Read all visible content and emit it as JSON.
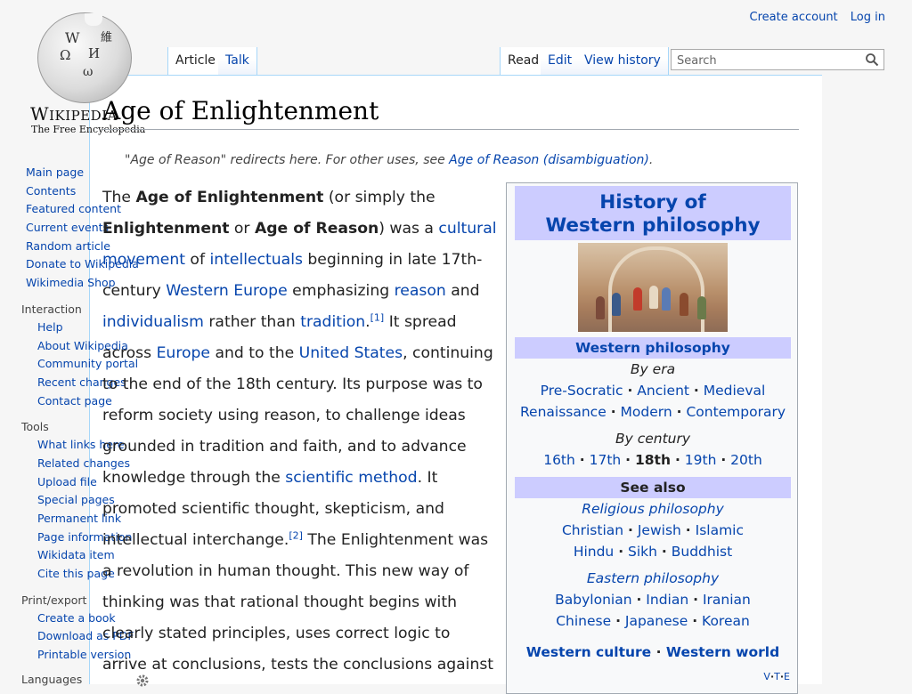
{
  "logo": {
    "wordmark_big": "W",
    "wordmark_rest": "IKIPEDIA",
    "tagline": "The Free Encyclopedia",
    "globe_glyphs": [
      "W",
      "Ω",
      "И",
      "ω",
      "維"
    ]
  },
  "personal": {
    "create_account": "Create account",
    "log_in": "Log in"
  },
  "tabs": {
    "article": "Article",
    "talk": "Talk",
    "read": "Read",
    "edit": "Edit",
    "view_history": "View history"
  },
  "search": {
    "placeholder": "Search",
    "icon": "search-icon"
  },
  "sidebar": {
    "main": [
      {
        "label": "Main page"
      },
      {
        "label": "Contents"
      },
      {
        "label": "Featured content"
      },
      {
        "label": "Current events"
      },
      {
        "label": "Random article"
      },
      {
        "label": "Donate to Wikipedia"
      },
      {
        "label": "Wikimedia Shop"
      }
    ],
    "interaction": {
      "heading": "Interaction",
      "items": [
        {
          "label": "Help"
        },
        {
          "label": "About Wikipedia"
        },
        {
          "label": "Community portal"
        },
        {
          "label": "Recent changes"
        },
        {
          "label": "Contact page"
        }
      ]
    },
    "tools": {
      "heading": "Tools",
      "items": [
        {
          "label": "What links here"
        },
        {
          "label": "Related changes"
        },
        {
          "label": "Upload file"
        },
        {
          "label": "Special pages"
        },
        {
          "label": "Permanent link"
        },
        {
          "label": "Page information"
        },
        {
          "label": "Wikidata item"
        },
        {
          "label": "Cite this page"
        }
      ]
    },
    "print": {
      "heading": "Print/export",
      "items": [
        {
          "label": "Create a book"
        },
        {
          "label": "Download as PDF"
        },
        {
          "label": "Printable version"
        }
      ]
    },
    "languages": {
      "heading": "Languages"
    }
  },
  "article": {
    "title": "Age of Enlightenment",
    "hatnote_text": "\"Age of Reason\" redirects here. For other uses, see ",
    "hatnote_link": "Age of Reason (disambiguation)",
    "hatnote_end": ".",
    "p": {
      "t1": "The ",
      "b1": "Age of Enlightenment",
      "t2": " (or simply the ",
      "b2": "Enlightenment",
      "t3": " or ",
      "b3": "Age of Reason",
      "t4": ") was a ",
      "l_cultural": "cultural movement",
      "t5": " of ",
      "l_intellectuals": "intellectuals",
      "t6": " beginning in late 17th-century ",
      "l_western_europe": "Western Europe",
      "t7": " emphasizing ",
      "l_reason": "reason",
      "t8": " and ",
      "l_individualism": "individualism",
      "t9": " rather than ",
      "l_tradition": "tradition",
      "t10": ".",
      "ref1": "[1]",
      "t11": " It spread across ",
      "l_europe": "Europe",
      "t12": " and to the ",
      "l_us": "United States",
      "t13": ", continuing to the end of the 18th century. Its purpose was to reform society using reason, to challenge ideas grounded in tradition and faith, and to advance knowledge through the ",
      "l_scientific": "scientific method",
      "t14": ". It promoted scientific thought, skepticism, and intellectual interchange.",
      "ref2": "[2]",
      "t15": " The Enlightenment was a revolution in human thought. This new way of thinking was that rational thought begins with clearly stated principles, uses correct logic to arrive at conclusions, tests the conclusions against"
    }
  },
  "infobox": {
    "title_line1": "History of",
    "title_line2": "Western philosophy",
    "subtitle": "Western philosophy",
    "by_era": "By era",
    "era_row1": [
      "Pre-Socratic",
      "Ancient",
      "Medieval"
    ],
    "era_row2": [
      "Renaissance",
      "Modern",
      "Contemporary"
    ],
    "by_century": "By century",
    "centuries": [
      "16th",
      "17th",
      "18th",
      "19th",
      "20th"
    ],
    "current_century": "18th",
    "see_also": "See also",
    "religious": "Religious philosophy",
    "religions": [
      "Christian",
      "Jewish",
      "Islamic"
    ],
    "religions2": [
      "Hindu",
      "Sikh",
      "Buddhist"
    ],
    "eastern": "Eastern philosophy",
    "eastern1": [
      "Babylonian",
      "Indian",
      "Iranian"
    ],
    "eastern2": [
      "Chinese",
      "Japanese",
      "Korean"
    ],
    "footer": [
      "Western culture",
      "Western world"
    ],
    "vte": [
      "V",
      "T",
      "E"
    ],
    "separator": "·"
  }
}
